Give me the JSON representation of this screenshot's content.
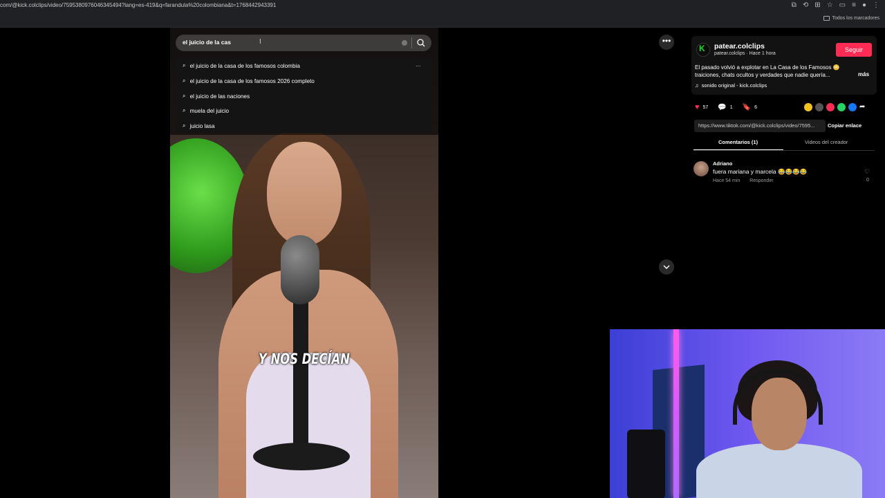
{
  "browser": {
    "url": "com/@kick.colclips/video/7595380976046345494?lang=es-419&q=farandula%20colombiana&t=1768442943391",
    "bookmarks_label": "Todos los marcadores"
  },
  "search": {
    "query": "el juicio de la cas",
    "suggestions": [
      "el juicio de la casa de los famosos colombia",
      "el juicio de la casa de los famosos 2026 completo",
      "el juicio de las naciones",
      "muela del juicio",
      "juicio lasa"
    ],
    "more_label": "..."
  },
  "video": {
    "caption": "Y NOS DECÍAN"
  },
  "creator": {
    "name": "patear.colclips",
    "subline": "patear.colclips · Hace 1 hora",
    "follow_label": "Seguir",
    "description": "El pasado volvió a explotar en La Casa de los Famosos 😳 traiciones, chats ocultos y verdades que nadie quería...",
    "more_label": "más",
    "sound": "sonido original - kick.colclips"
  },
  "stats": {
    "likes": "57",
    "comments": "1",
    "saves": "6"
  },
  "share": {
    "link": "https://www.tiktok.com/@kick.colclips/video/7595...",
    "copy_label": "Copiar enlace",
    "colors": [
      "#f4c21f",
      "#555555",
      "#fe2c55",
      "#25d366",
      "#1877f2"
    ]
  },
  "tabs": {
    "comments": "Comentarios (1)",
    "creator_videos": "Videos del creador"
  },
  "comment": {
    "author": "Adriano",
    "text": "fuera mariana y marcela 😂😂😂😂",
    "time": "Hace 54 min",
    "reply": "Responder",
    "likes": "0"
  },
  "colors": {
    "accent": "#fe2c55",
    "background": "#000000",
    "brand_k": "#1cdb2b"
  }
}
